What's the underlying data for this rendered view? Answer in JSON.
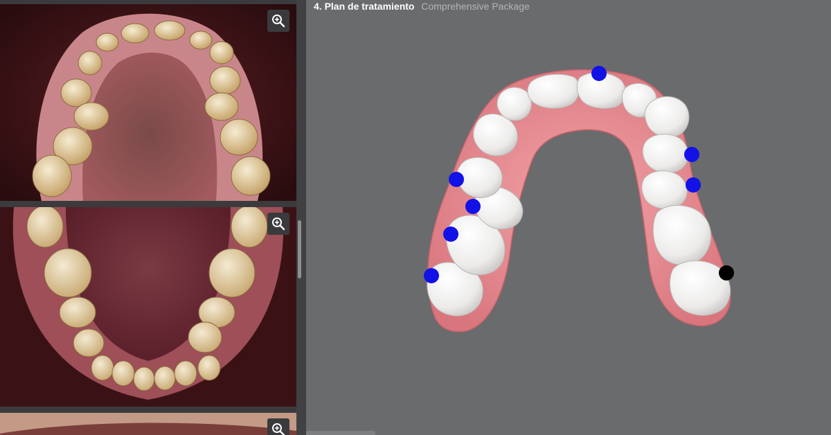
{
  "header": {
    "step_title": "4. Plan de tratamiento",
    "package_name": "Comprehensive Package"
  },
  "photos": [
    {
      "name": "upper-occlusal-photo",
      "zoom_icon": "zoom-in-icon"
    },
    {
      "name": "lower-occlusal-photo",
      "zoom_icon": "zoom-in-icon"
    },
    {
      "name": "third-photo",
      "zoom_icon": "zoom-in-icon"
    }
  ],
  "markers": {
    "count_blue": 7,
    "count_black": 1,
    "blue_color": "#1212e6",
    "black_color": "#000000"
  },
  "colors": {
    "viewer_bg": "#6a6b6d",
    "gum": "#e98b91",
    "tooth": "#f3f1ef"
  }
}
